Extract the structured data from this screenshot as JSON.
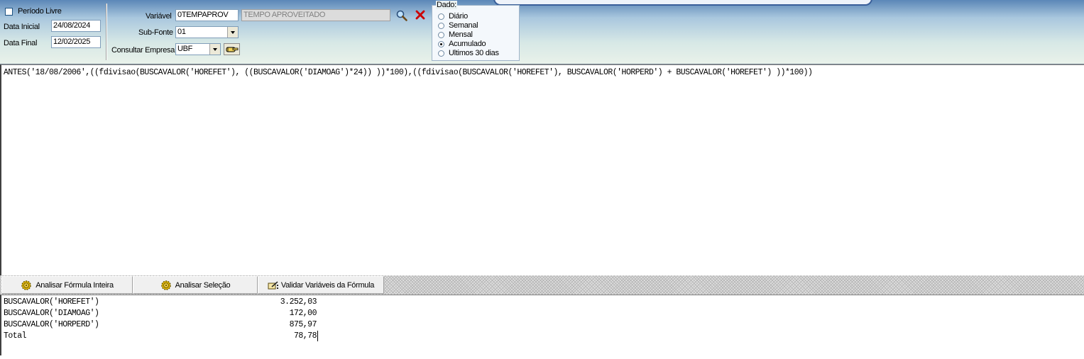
{
  "filters": {
    "periodo_livre_label": "Período Livre",
    "periodo_livre_checked": false,
    "data_inicial_label": "Data Inicial",
    "data_inicial_value": "24/08/2024",
    "data_final_label": "Data Final",
    "data_final_value": "12/02/2025",
    "variavel_label": "Variável",
    "variavel_code": "0TEMPAPROV",
    "variavel_description": "TEMPO APROVEITADO",
    "subfonte_label": "Sub-Fonte",
    "subfonte_value": "01",
    "empresa_label": "Consultar Empresa",
    "empresa_value": "UBF"
  },
  "dado": {
    "title": "Dado:",
    "options": [
      "Diário",
      "Semanal",
      "Mensal",
      "Acumulado",
      "Ultimos 30 dias"
    ],
    "selected": "Acumulado"
  },
  "formula": "ANTES('18/08/2006',((fdivisao(BUSCAVALOR('HOREFET'), ((BUSCAVALOR('DIAMOAG')*24)) ))*100),((fdivisao(BUSCAVALOR('HOREFET'), BUSCAVALOR('HORPERD') + BUSCAVALOR('HOREFET') ))*100))",
  "toolbar": {
    "analisar_inteira": "Analisar Fórmula Inteira",
    "analisar_selecao": "Analisar Seleção",
    "validar_variaveis": "Validar Variáveis da Fórmula"
  },
  "results": [
    {
      "name": "BUSCAVALOR('HOREFET')",
      "value": "3.252,03"
    },
    {
      "name": "BUSCAVALOR('DIAMOAG')",
      "value": "172,00"
    },
    {
      "name": "BUSCAVALOR('HORPERD')",
      "value": "875,97"
    },
    {
      "name": "Total",
      "value": "78,78"
    }
  ],
  "icons": {
    "search": "magnifier-icon",
    "close": "red-x-icon",
    "empresa": "hand-pointer-icon",
    "analyze": "gear-icon",
    "validate": "pencil-check-icon"
  },
  "colors": {
    "header_top": "#5b87b7",
    "header_bottom": "#e9f2ea",
    "close_red": "#cc0000"
  }
}
